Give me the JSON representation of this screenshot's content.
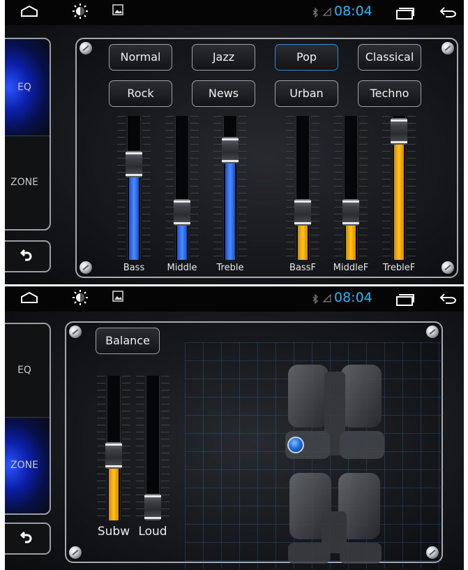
{
  "statusbar": {
    "time": "08:04",
    "icons": [
      "home-icon",
      "brightness-icon",
      "image-icon",
      "bluetooth-icon",
      "signal-icon",
      "recent-apps-icon",
      "back-icon"
    ]
  },
  "sidebar": {
    "items": [
      {
        "label": "EQ"
      },
      {
        "label": "ZONE"
      }
    ]
  },
  "eq": {
    "presets": [
      "Normal",
      "Jazz",
      "Pop",
      "Classical",
      "Rock",
      "News",
      "Urban",
      "Techno"
    ],
    "selected_preset": "Pop",
    "sliders": [
      {
        "label": "Bass",
        "level": 0.7,
        "color": "#3b82f6"
      },
      {
        "label": "Middle",
        "level": 0.29,
        "color": "#3b82f6"
      },
      {
        "label": "Treble",
        "level": 0.82,
        "color": "#3b82f6"
      },
      {
        "label": "BassF",
        "level": 0.29,
        "color": "#f5b400"
      },
      {
        "label": "MiddleF",
        "level": 0.29,
        "color": "#f5b400"
      },
      {
        "label": "TrebleF",
        "level": 0.98,
        "color": "#f5b400"
      }
    ]
  },
  "zone": {
    "balance_label": "Balance",
    "sliders": [
      {
        "label": "Subw",
        "level": 0.44,
        "color": "#f5b400"
      },
      {
        "label": "Loud",
        "level": 0.0,
        "color": "#f5b400"
      }
    ]
  },
  "colors": {
    "accent_blue": "#29b6f6",
    "eq_blue": "#3b82f6",
    "eq_yellow": "#f5b400"
  }
}
